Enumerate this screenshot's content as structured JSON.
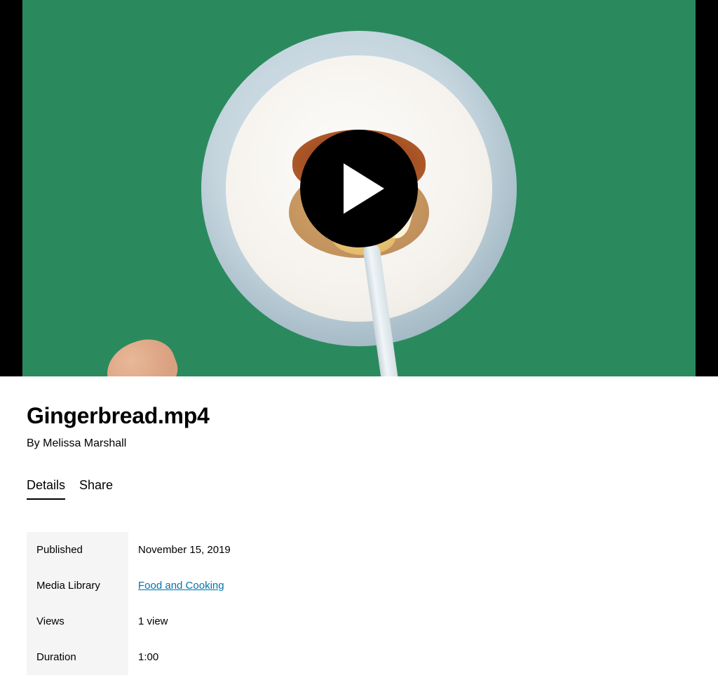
{
  "video": {
    "title": "Gingerbread.mp4",
    "author": "By Melissa Marshall"
  },
  "tabs": {
    "details": "Details",
    "share": "Share"
  },
  "details": {
    "published_label": "Published",
    "published_value": "November 15, 2019",
    "media_library_label": "Media Library",
    "media_library_link": "Food and Cooking",
    "views_label": "Views",
    "views_value": "1 view",
    "duration_label": "Duration",
    "duration_value": "1:00"
  }
}
